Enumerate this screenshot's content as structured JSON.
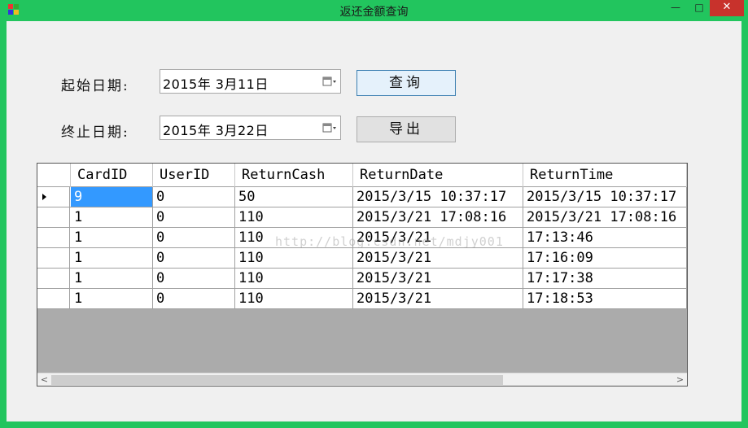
{
  "window": {
    "title": "返还金额查询",
    "controls": {
      "minimize": "—",
      "maximize": "□",
      "close": "✕"
    }
  },
  "form": {
    "start_label": "起始日期:",
    "start_value": "2015年  3月11日",
    "end_label": "终止日期:",
    "end_value": "2015年  3月22日",
    "query_button": "查询",
    "export_button": "导出"
  },
  "grid": {
    "columns": [
      "CardID",
      "UserID",
      "ReturnCash",
      "ReturnDate",
      "ReturnTime"
    ],
    "rows": [
      [
        "9",
        "0",
        "50",
        "2015/3/15 10:37:17",
        "2015/3/15 10:37:17"
      ],
      [
        "1",
        "0",
        "110",
        "2015/3/21 17:08:16",
        "2015/3/21 17:08:16"
      ],
      [
        "1",
        "0",
        "110",
        "2015/3/21",
        "17:13:46"
      ],
      [
        "1",
        "0",
        "110",
        "2015/3/21",
        "17:16:09"
      ],
      [
        "1",
        "0",
        "110",
        "2015/3/21",
        "17:17:38"
      ],
      [
        "1",
        "0",
        "110",
        "2015/3/21",
        "17:18:53"
      ]
    ],
    "selected_row": 0
  },
  "watermark": "http://blog.csdn.net/mdjy001",
  "colors": {
    "title_bar": "#22c55e",
    "selection": "#3399ff",
    "close_button": "#c8322c"
  }
}
